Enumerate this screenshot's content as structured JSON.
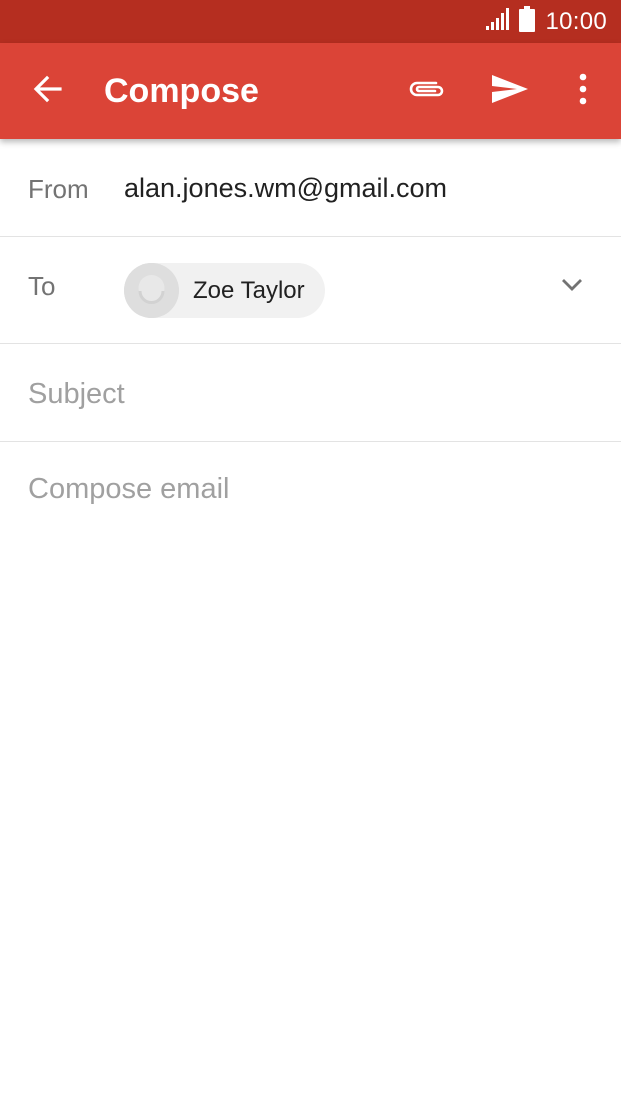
{
  "status_bar": {
    "time": "10:00",
    "signal_icon": "signal-icon",
    "battery_icon": "battery-icon"
  },
  "toolbar": {
    "title": "Compose",
    "back_icon": "arrow-back-icon",
    "attach_icon": "paperclip-icon",
    "send_icon": "send-icon",
    "more_icon": "more-vert-icon"
  },
  "from": {
    "label": "From",
    "value": "alan.jones.wm@gmail.com"
  },
  "to": {
    "label": "To",
    "recipients": [
      {
        "name": "Zoe Taylor",
        "avatar_icon": "contact-avatar-icon"
      }
    ],
    "expand_icon": "chevron-down-icon"
  },
  "subject": {
    "value": "",
    "placeholder": "Subject"
  },
  "body": {
    "value": "",
    "placeholder": "Compose email"
  },
  "colors": {
    "status_bar": "#b52e20",
    "toolbar": "#db4437",
    "label_text": "#737373",
    "placeholder_text": "#a0a0a0",
    "divider": "#e3e3e3"
  }
}
